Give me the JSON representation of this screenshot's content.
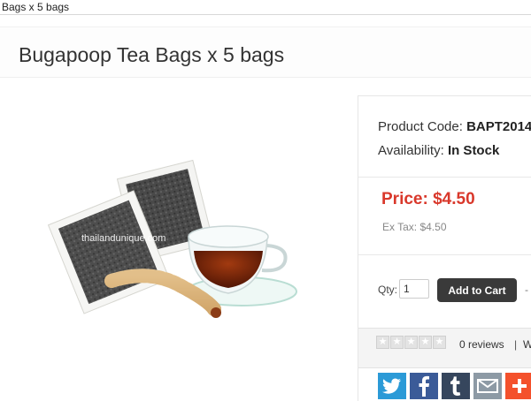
{
  "browser": {
    "tab_title": "Bags x 5 bags"
  },
  "page": {
    "title": "Bugapoop Tea Bags x 5 bags"
  },
  "image": {
    "watermark": "thailandunique.com"
  },
  "product": {
    "code_label": "Product Code:",
    "code_value": "BAPT2014",
    "availability_label": "Availability:",
    "availability_value": "In Stock",
    "price": "Price: $4.50",
    "ex_tax": "Ex Tax: $4.50"
  },
  "cart": {
    "qty_label": "Qty:",
    "qty_value": "1",
    "add_label": "Add to Cart",
    "dash": "-"
  },
  "reviews": {
    "count_label": "0 reviews",
    "separator": "|",
    "write_label": "W",
    "rating": 0,
    "stars_total": 5
  },
  "share": {
    "icons": [
      "twitter-icon",
      "facebook-icon",
      "tumblr-icon",
      "email-icon",
      "more-icon"
    ],
    "colors": {
      "twitter": "#2b9ad7",
      "facebook": "#3b5b98",
      "tumblr": "#36465d",
      "email": "#8d9aa5",
      "more": "#f4512c"
    }
  },
  "colors": {
    "price": "#d9382b",
    "button": "#3a3a3a"
  }
}
